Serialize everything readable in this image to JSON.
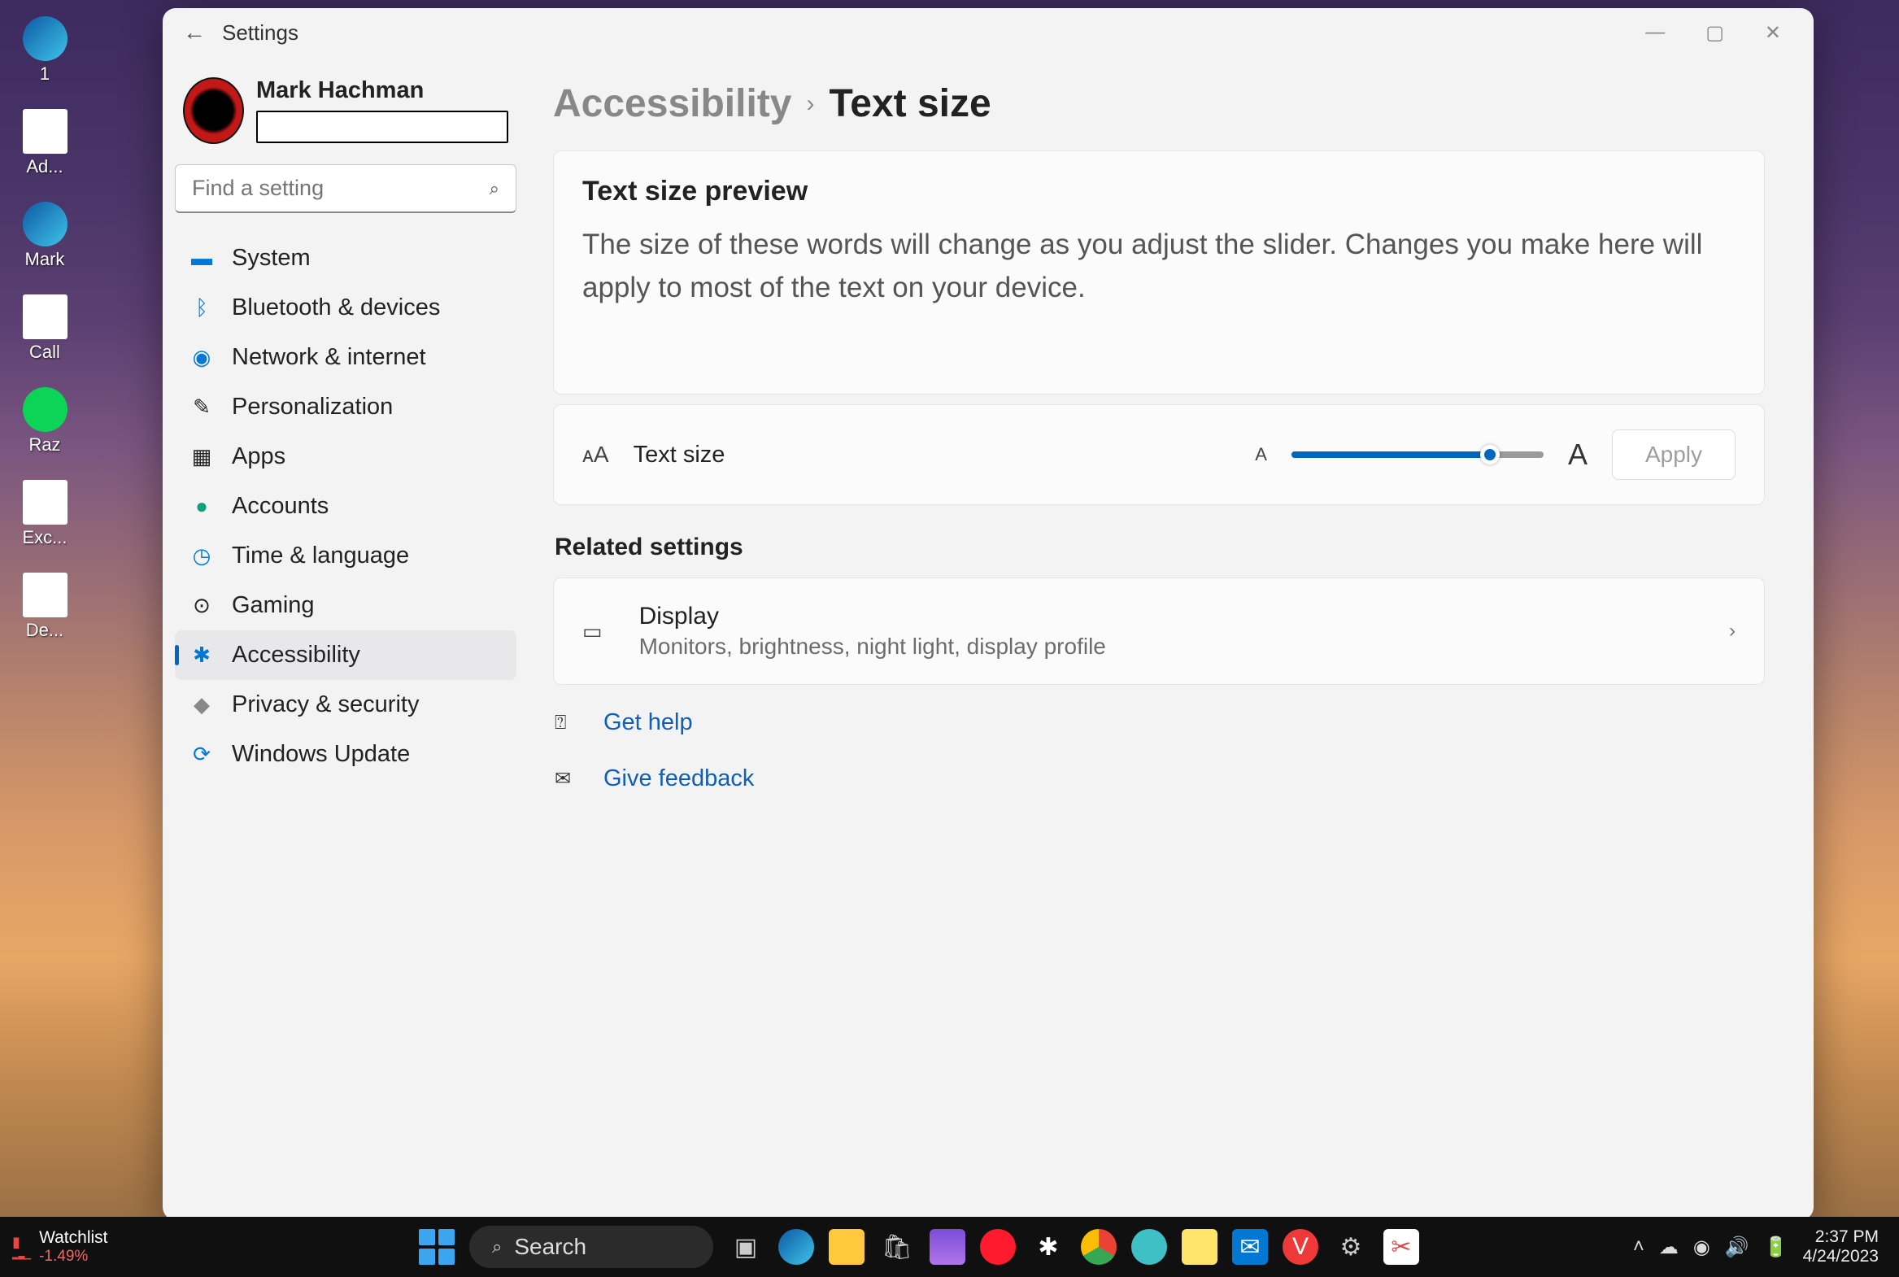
{
  "desktop": {
    "icons": [
      {
        "label": "1"
      },
      {
        "label": "Ad..."
      },
      {
        "label": "Mark"
      },
      {
        "label": "Call"
      },
      {
        "label": "Raz"
      },
      {
        "label": "Exc..."
      },
      {
        "label": "De..."
      }
    ]
  },
  "window": {
    "title": "Settings",
    "user_name": "Mark Hachman"
  },
  "search": {
    "placeholder": "Find a setting"
  },
  "sidebar": {
    "items": [
      {
        "icon": "🖥️",
        "label": "System"
      },
      {
        "icon": "ᛒ",
        "label": "Bluetooth & devices"
      },
      {
        "icon": "📶",
        "label": "Network & internet"
      },
      {
        "icon": "🖌️",
        "label": "Personalization"
      },
      {
        "icon": "▦",
        "label": "Apps"
      },
      {
        "icon": "👤",
        "label": "Accounts"
      },
      {
        "icon": "🕒",
        "label": "Time & language"
      },
      {
        "icon": "🎮",
        "label": "Gaming"
      },
      {
        "icon": "✱",
        "label": "Accessibility",
        "active": true
      },
      {
        "icon": "🛡️",
        "label": "Privacy & security"
      },
      {
        "icon": "🔄",
        "label": "Windows Update"
      }
    ]
  },
  "breadcrumb": {
    "parent": "Accessibility",
    "current": "Text size"
  },
  "preview": {
    "heading": "Text size preview",
    "body": "The size of these words will change as you adjust the slider. Changes you make here will apply to most of the text on your device."
  },
  "textsize": {
    "label": "Text size",
    "apply": "Apply",
    "small_a": "A",
    "big_a": "A"
  },
  "related": {
    "heading": "Related settings",
    "display": {
      "title": "Display",
      "sub": "Monitors, brightness, night light, display profile"
    }
  },
  "help": {
    "get_help": "Get help",
    "give_feedback": "Give feedback"
  },
  "taskbar": {
    "watchlist_label": "Watchlist",
    "watchlist_value": "-1.49%",
    "search": "Search",
    "time": "2:37 PM",
    "date": "4/24/2023"
  }
}
